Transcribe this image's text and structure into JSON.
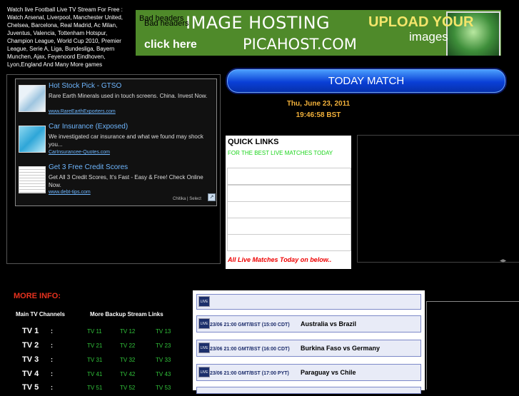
{
  "top_description": "Watch live Football Live TV Stream For Free : Watch Arsenal, Liverpool, Manchester United, Chelsea, Barcelona, Real Madrid, Ac Milan, Juventus, Valencia, Tottenham Hotspur, Champion League, World Cup 2010, Premier League, Serie A, Liga, Bundesliga, Bayern Munchen, Ajax, Feyenoord Eindhoven, Lyon,England And Many More games",
  "banner": {
    "bad_header_1": "Bad headers",
    "bad_header_2": "Bad headers",
    "title": "IMAGE HOSTING",
    "click_here": "click here",
    "site": "PICAHOST.COM",
    "upload": "UPLOAD YOUR",
    "images": "images"
  },
  "ads": [
    {
      "title": "Hot Stock Pick - GTSO",
      "desc": "Rare Earth Minerals used in touch screens. China. Invest Now.",
      "url": "www.RareEarthExporters.com"
    },
    {
      "title": "Car Insurance (Exposed)",
      "desc": "We investigated car insurance and what we found may shock you...",
      "url": "CarInsurancee-Quotes.com"
    },
    {
      "title": "Get 3 Free Credit Scores",
      "desc": "Get All 3 Credit Scores, It's Fast - Easy & Free! Check Online Now.",
      "url": "www.debt-tips.com"
    }
  ],
  "chitika": "Chitika | Select",
  "today_match": "TODAY MATCH",
  "date": "Thu, June 23, 2011",
  "time": "19:46:58 BST",
  "quick_links": {
    "title": "QUICK LINKS",
    "subtitle": "FOR THE BEST LIVE MATCHES TODAY",
    "live_text": "All Live Matches Today on below.."
  },
  "more_info": "MORE INFO:",
  "main_channels_header": "Main TV Channels",
  "backup_header": "More Backup Stream Links",
  "tv_rows": [
    {
      "name": "TV 1",
      "colon": ":",
      "links": [
        "TV 11",
        "TV 12",
        "TV 13"
      ]
    },
    {
      "name": "TV 2",
      "colon": ":",
      "links": [
        "TV 21",
        "TV 22",
        "TV 23"
      ]
    },
    {
      "name": "TV 3",
      "colon": ":",
      "links": [
        "TV 31",
        "TV 32",
        "TV 33"
      ]
    },
    {
      "name": "TV 4",
      "colon": ":",
      "links": [
        "TV 41",
        "TV 42",
        "TV 43"
      ]
    },
    {
      "name": "TV 5",
      "colon": ":",
      "links": [
        "TV 51",
        "TV 52",
        "TV 53"
      ]
    }
  ],
  "live_icon": "LIVE",
  "matches": [
    {
      "time": "",
      "teams": ""
    },
    {
      "time": "23/06 21:00 GMT/BST (15:00 CDT)",
      "teams": "Australia vs Brazil"
    },
    {
      "time": "23/06 21:00 GMT/BST (16:00 CDT)",
      "teams": "Burkina Faso vs Germany"
    },
    {
      "time": "23/06 21:00 GMT/BST (17:00 PYT)",
      "teams": "Paraguay vs Chile"
    }
  ]
}
